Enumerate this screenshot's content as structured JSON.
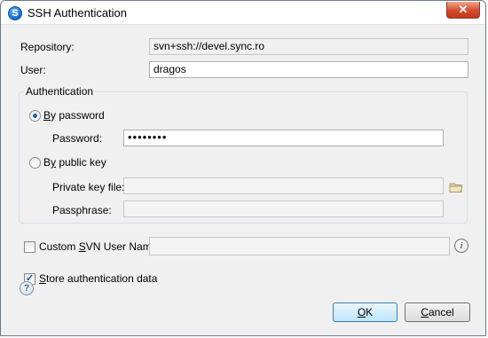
{
  "window": {
    "title": "SSH Authentication",
    "close_glyph": "✕",
    "app_icon": "S"
  },
  "form": {
    "repository_label": "Repository:",
    "repository_value": "svn+ssh://devel.sync.ro",
    "user_label": "User:",
    "user_value": "dragos"
  },
  "auth_group": {
    "title": "Authentication",
    "by_password": {
      "label": "By password",
      "mnemonic": "B",
      "rest": "y password",
      "selected": true
    },
    "password_label": "Password:",
    "password_value": "••••••••",
    "by_public_key": {
      "label": "By public key",
      "pre": "B",
      "mnemonic": "y",
      "rest": " public key",
      "selected": false
    },
    "private_key_label": "Private key file:",
    "private_key_value": "",
    "passphrase_label": "Passphrase:",
    "passphrase_value": ""
  },
  "custom_user": {
    "label": "Custom SVN User Name",
    "pre": "Custom ",
    "mnemonic": "S",
    "rest": "VN User Name",
    "checked": false,
    "value": ""
  },
  "store": {
    "label": "Store authentication data",
    "mnemonic": "S",
    "rest": "tore authentication data",
    "checked": true,
    "check_glyph": "✓"
  },
  "buttons": {
    "ok": {
      "label": "OK",
      "mnemonic": "O",
      "rest": "K"
    },
    "cancel": {
      "label": "Cancel",
      "pre": "",
      "mnemonic": "C",
      "rest": "ancel"
    }
  },
  "icons": {
    "info_glyph": "i",
    "help_glyph": "?"
  }
}
